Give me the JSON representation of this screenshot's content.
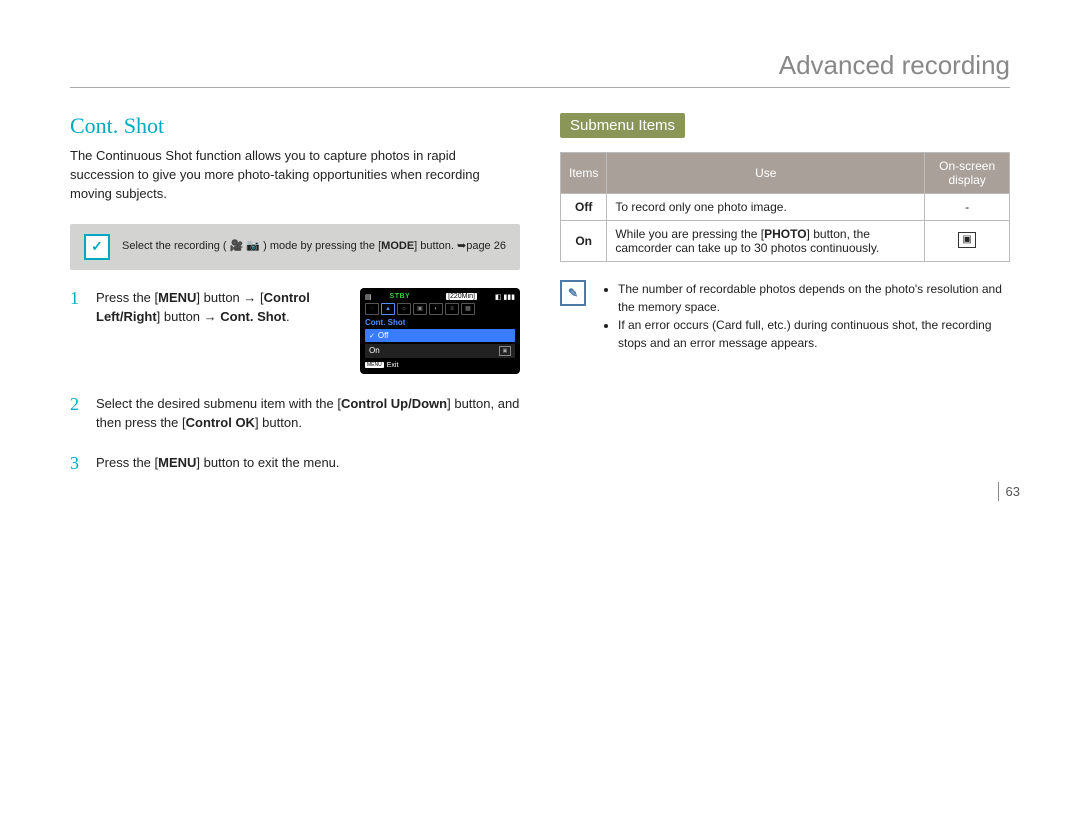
{
  "header": {
    "title": "Advanced recording"
  },
  "left": {
    "heading": "Cont. Shot",
    "intro": "The Continuous Shot function allows you to capture photos in rapid succession to give you more photo-taking opportunities when recording moving subjects.",
    "note": {
      "prefix": "Select the recording (",
      "mid": ") mode by pressing the [",
      "mode": "MODE",
      "suffix": "] button. ",
      "pageref": "page 26"
    },
    "steps": {
      "s1": {
        "num": "1",
        "a": "Press the [",
        "menu": "MENU",
        "b": "] button → [",
        "ctrl": "Control Left/Right",
        "c": "] button → ",
        "target": "Cont. Shot",
        "d": "."
      },
      "s2": {
        "num": "2",
        "a": "Select the desired submenu item with the [",
        "updown": "Control Up/Down",
        "b": "] button, and then press the [",
        "ok": "Control OK",
        "c": "] button."
      },
      "s3": {
        "num": "3",
        "a": "Press the [",
        "menu": "MENU",
        "b": "] button to exit the menu."
      }
    },
    "lcd": {
      "status": "STBY",
      "time": "[220Min]",
      "menu_title": "Cont. Shot",
      "opt_off": "Off",
      "opt_on": "On",
      "exit_badge": "MENU",
      "exit": "Exit"
    }
  },
  "right": {
    "badge": "Submenu Items",
    "table": {
      "h1": "Items",
      "h2": "Use",
      "h3": "On-screen display",
      "r1_item": "Off",
      "r1_use": "To record only one photo image.",
      "r1_osd": "-",
      "r2_item": "On",
      "r2_use_a": "While you are pressing the [",
      "r2_photo": "PHOTO",
      "r2_use_b": "] button, the camcorder can take up to 30 photos continuously."
    },
    "tips": {
      "t1": "The number of recordable photos depends on the photo's resolution and the memory space.",
      "t2": "If an error occurs (Card full, etc.) during continuous shot, the recording stops and an error message appears."
    }
  },
  "page_number": "63"
}
